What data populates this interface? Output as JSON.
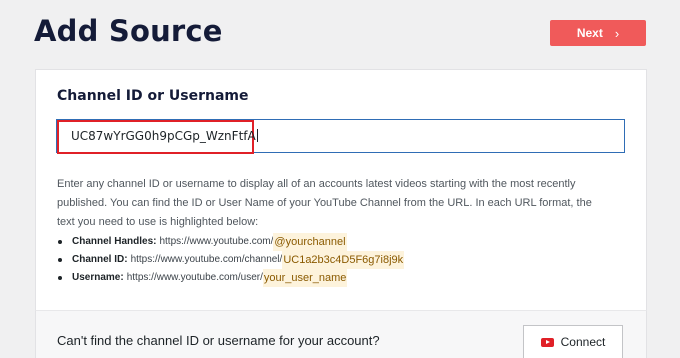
{
  "header": {
    "title": "Add Source",
    "next_label": "Next",
    "next_icon": "chevron-right-icon"
  },
  "form": {
    "field_label": "Channel ID or Username",
    "input_value": "UC87wYrGG0h9pCGp_WznFtfA",
    "help_text": "Enter any channel ID or username to display all of an accounts latest videos starting with the most recently published. You can find the ID or User Name of your YouTube Channel from the URL. In each URL format, the text you need to use is highlighted below:",
    "examples": [
      {
        "label": "Channel Handles:",
        "url": "https://www.youtube.com/",
        "highlight": "@yourchannel"
      },
      {
        "label": "Channel ID:",
        "url": "https://www.youtube.com/channel/",
        "highlight": "UC1a2b3c4D5F6g7i8j9k"
      },
      {
        "label": "Username:",
        "url": "https://www.youtube.com/user/",
        "highlight": "your_user_name"
      }
    ]
  },
  "footer": {
    "prompt": "Can't find the channel ID or username for your account?",
    "connect_label": "Connect",
    "connect_icon": "youtube-icon"
  },
  "colors": {
    "accent": "#f05a5a",
    "input_border": "#2f6db5",
    "highlight_box": "#e02027"
  }
}
